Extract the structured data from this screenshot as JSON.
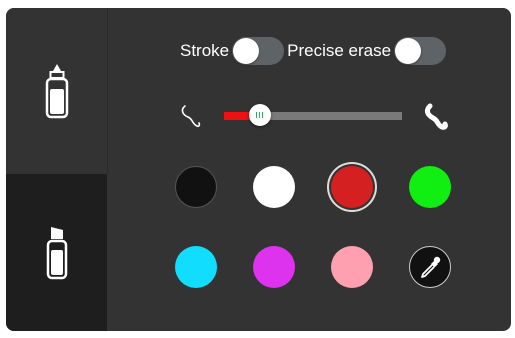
{
  "sidebar": {
    "tools": [
      {
        "name": "pen",
        "icon": "marker-pen-icon",
        "selected": false
      },
      {
        "name": "eraser",
        "icon": "eraser-icon",
        "selected": true
      }
    ]
  },
  "toggles": {
    "stroke_label": "Stroke",
    "stroke_on": false,
    "precise_erase_label": "Precise erase",
    "precise_erase_on": false
  },
  "size_slider": {
    "thin_icon": "thin-stroke-icon",
    "thick_icon": "thick-stroke-icon",
    "value_fraction": 0.2,
    "fill_color": "#ee1111"
  },
  "colors": [
    {
      "name": "black",
      "hex": "#111111",
      "selected": false
    },
    {
      "name": "white",
      "hex": "#ffffff",
      "selected": false
    },
    {
      "name": "red",
      "hex": "#d42020",
      "selected": true
    },
    {
      "name": "green",
      "hex": "#11ee11",
      "selected": false
    },
    {
      "name": "cyan",
      "hex": "#11ddff",
      "selected": false
    },
    {
      "name": "magenta",
      "hex": "#dd33ee",
      "selected": false
    },
    {
      "name": "pink",
      "hex": "#ffa0b0",
      "selected": false
    },
    {
      "name": "eyedropper",
      "hex": "#111111",
      "icon": "eyedropper-icon",
      "selected": false
    }
  ]
}
